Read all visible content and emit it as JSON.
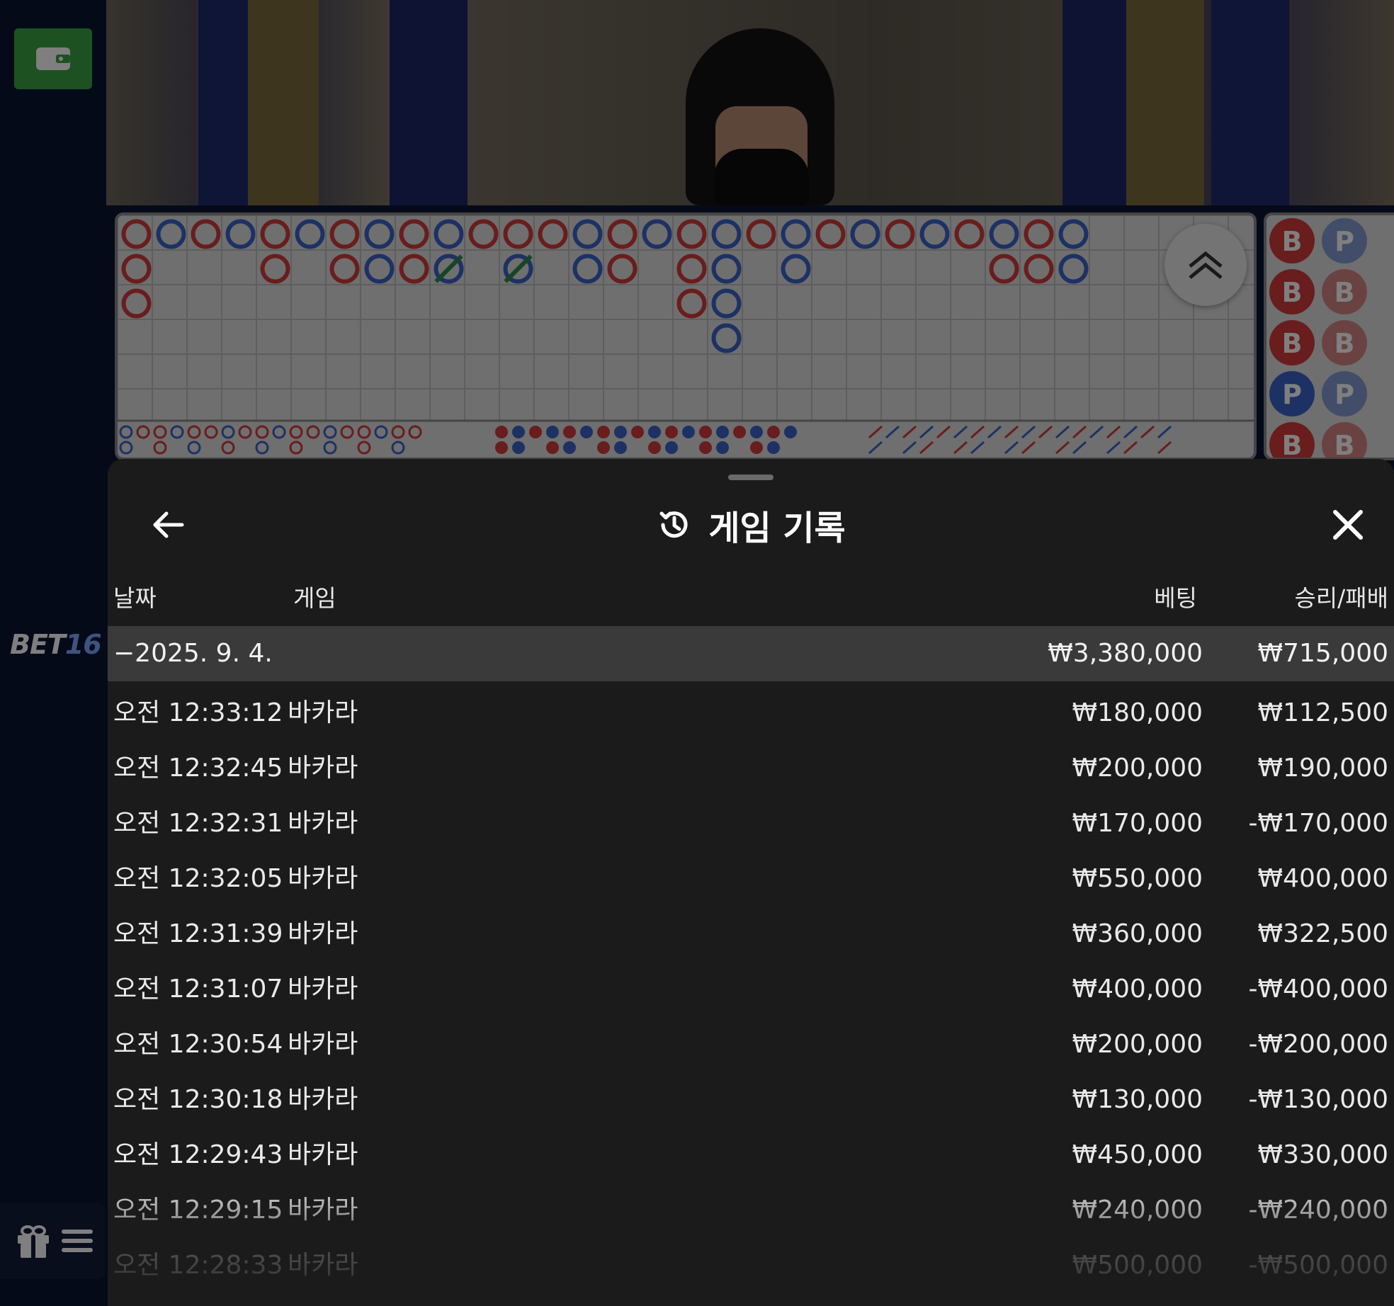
{
  "sidebar": {
    "brand_text": "BET",
    "brand_number": "16",
    "wallet_icon": "wallet-icon",
    "gift_icon": "gift-icon",
    "menu_icon": "hamburger-menu-icon",
    "accent_color": "#3aa343"
  },
  "video": {
    "description_icon": "live-dealer-video"
  },
  "roadmap": {
    "banker_color": "#d23a3a",
    "player_color": "#3a63c8",
    "tie_color": "#2e8a48",
    "side_beads": [
      [
        "B",
        "P"
      ],
      [
        "B",
        "B"
      ],
      [
        "B",
        "B"
      ],
      [
        "P",
        "P"
      ],
      [
        "B",
        "B"
      ]
    ]
  },
  "history": {
    "title": "게임 기록",
    "back_icon": "arrow-left-icon",
    "history_icon": "history-clock-icon",
    "close_icon": "close-icon",
    "columns": {
      "date": "날짜",
      "game": "게임",
      "bet": "베팅",
      "win_loss": "승리/패배"
    },
    "date_group": {
      "date": "−2025. 9. 4.",
      "bet_total": "₩3,380,000",
      "win_total": "₩715,000"
    },
    "rows": [
      {
        "time": "오전 12:33:12",
        "game": "바카라",
        "bet": "₩180,000",
        "result": "₩112,500"
      },
      {
        "time": "오전 12:32:45",
        "game": "바카라",
        "bet": "₩200,000",
        "result": "₩190,000"
      },
      {
        "time": "오전 12:32:31",
        "game": "바카라",
        "bet": "₩170,000",
        "result": "-₩170,000"
      },
      {
        "time": "오전 12:32:05",
        "game": "바카라",
        "bet": "₩550,000",
        "result": "₩400,000"
      },
      {
        "time": "오전 12:31:39",
        "game": "바카라",
        "bet": "₩360,000",
        "result": "₩322,500"
      },
      {
        "time": "오전 12:31:07",
        "game": "바카라",
        "bet": "₩400,000",
        "result": "-₩400,000"
      },
      {
        "time": "오전 12:30:54",
        "game": "바카라",
        "bet": "₩200,000",
        "result": "-₩200,000"
      },
      {
        "time": "오전 12:30:18",
        "game": "바카라",
        "bet": "₩130,000",
        "result": "-₩130,000"
      },
      {
        "time": "오전 12:29:43",
        "game": "바카라",
        "bet": "₩450,000",
        "result": "₩330,000"
      },
      {
        "time": "오전 12:29:15",
        "game": "바카라",
        "bet": "₩240,000",
        "result": "-₩240,000"
      },
      {
        "time": "오전 12:28:33",
        "game": "바카라",
        "bet": "₩500,000",
        "result": "-₩500,000"
      }
    ]
  }
}
